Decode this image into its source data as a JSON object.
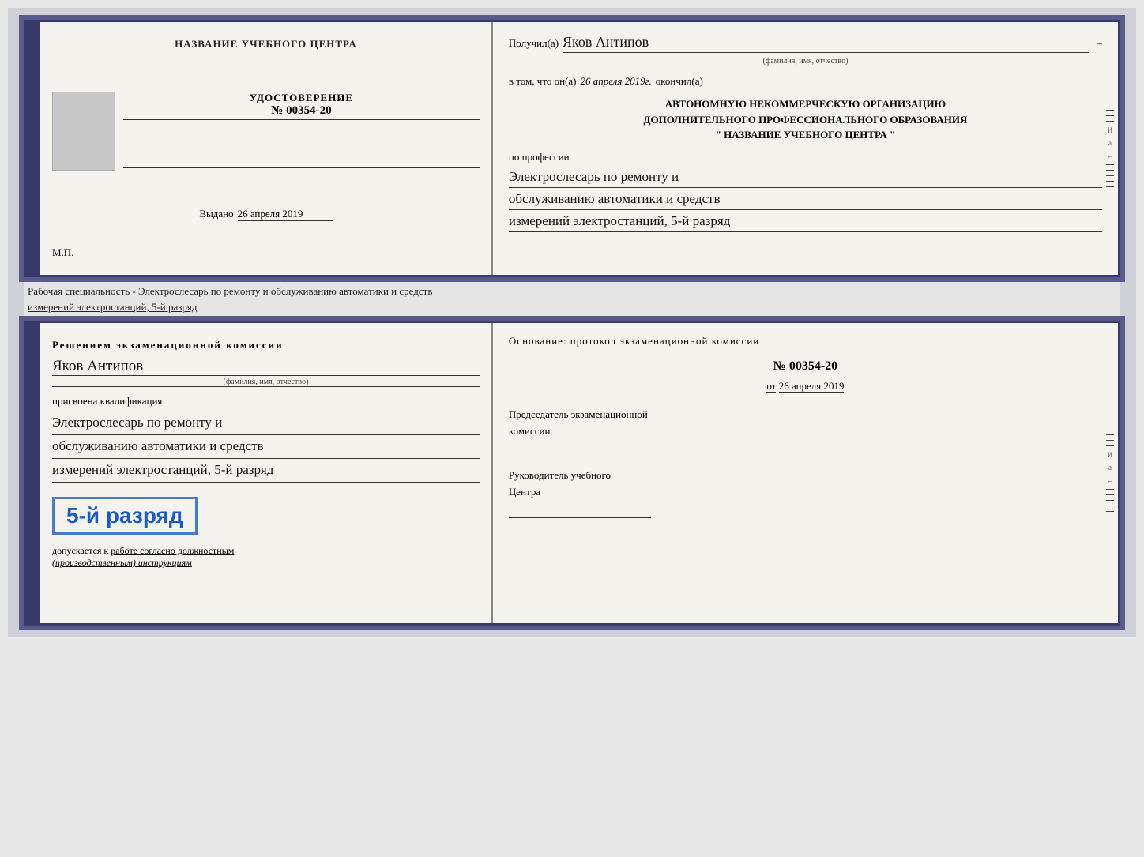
{
  "page": {
    "background_color": "#d0d0d8"
  },
  "top_cert": {
    "left": {
      "title": "НАЗВАНИЕ УЧЕБНОГО ЦЕНТРА",
      "cert_label": "УДОСТОВЕРЕНИЕ",
      "cert_number": "№ 00354-20",
      "date_label": "Выдано",
      "date_value": "26 апреля 2019",
      "mp": "М.П."
    },
    "right": {
      "recipient_label": "Получил(а)",
      "recipient_name": "Яков Антипов",
      "recipient_sub": "(фамилия, имя, отчество)",
      "statement": "в том, что он(а)",
      "statement_date": "26 апреля 2019г.",
      "statement_end": "окончил(а)",
      "org_line1": "АВТОНОМНУЮ НЕКОММЕРЧЕСКУЮ ОРГАНИЗАЦИЮ",
      "org_line2": "ДОПОЛНИТЕЛЬНОГО ПРОФЕССИОНАЛЬНОГО ОБРАЗОВАНИЯ",
      "org_line3": "\" НАЗВАНИЕ УЧЕБНОГО ЦЕНТРА \"",
      "profession_label": "по профессии",
      "profession_line1": "Электрослесарь по ремонту и",
      "profession_line2": "обслуживанию автоматики и средств",
      "profession_line3": "измерений электростанций, 5-й разряд"
    }
  },
  "description": {
    "text_line1": "Рабочая специальность - Электрослесарь по ремонту и обслуживанию автоматики и средств",
    "text_line2": "измерений электростанций, 5-й разряд"
  },
  "bottom_cert": {
    "left": {
      "decision_title": "Решением экзаменационной комиссии",
      "name": "Яков Антипов",
      "name_sub": "(фамилия, имя, отчество)",
      "qualification_label": "присвоена квалификация",
      "qualification_line1": "Электрослесарь по ремонту и",
      "qualification_line2": "обслуживанию автоматики и средств",
      "qualification_line3": "измерений электростанций, 5-й разряд",
      "rank_badge": "5-й разряд",
      "допуск_label": "допускается к",
      "допуск_value": "работе согласно должностным",
      "допуск_italic": "(производственным) инструкциям"
    },
    "right": {
      "basis_label": "Основание: протокол экзаменационной комиссии",
      "basis_number": "№ 00354-20",
      "basis_date_prefix": "от",
      "basis_date": "26 апреля 2019",
      "chairman_label": "Председатель экзаменационной",
      "chairman_sub": "комиссии",
      "director_label": "Руководитель учебного",
      "director_sub": "Центра"
    }
  }
}
